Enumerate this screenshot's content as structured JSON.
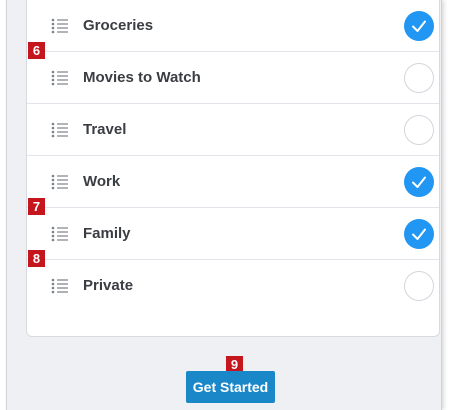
{
  "lists": [
    {
      "label": "Groceries",
      "checked": true
    },
    {
      "label": "Movies to Watch",
      "checked": false
    },
    {
      "label": "Travel",
      "checked": false
    },
    {
      "label": "Work",
      "checked": true
    },
    {
      "label": "Family",
      "checked": true
    },
    {
      "label": "Private",
      "checked": false
    }
  ],
  "callouts": {
    "groceries": "6",
    "work": "7",
    "family": "8",
    "get_started": "9"
  },
  "footer": {
    "button_label": "Get Started"
  },
  "colors": {
    "accent": "#2196f3",
    "button": "#1a87c9",
    "callout": "#c4161c"
  },
  "icons": {
    "row_icon": "list-icon",
    "check_icon": "checkmark-icon"
  }
}
